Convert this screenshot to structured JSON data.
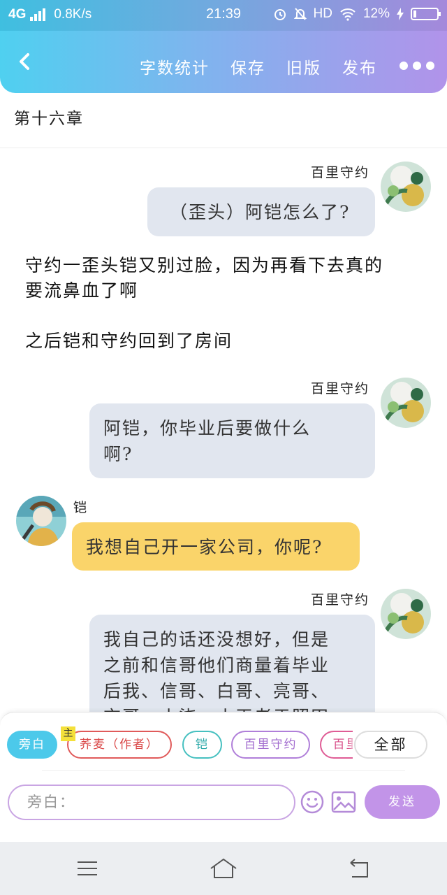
{
  "status": {
    "network": "4G",
    "speed": "0.8K/s",
    "time": "21:39",
    "hd": "HD",
    "battery_text": "12%",
    "battery_level": 0.12
  },
  "toolbar": {
    "back_icon": "chevron-left-icon",
    "actions": [
      "字数统计",
      "保存",
      "旧版",
      "发布"
    ],
    "more_icon": "more-dots-icon"
  },
  "chapter": {
    "title": "第十六章"
  },
  "feed": {
    "msg1": {
      "name": "百里守约",
      "text": "（歪头）阿铠怎么了?"
    },
    "narration1": {
      "line1": "守约一歪头铠又别过脸，因为再看下去真的",
      "line2": "要流鼻血了啊"
    },
    "narration2": {
      "text": "之后铠和守约回到了房间"
    },
    "msg2": {
      "name": "百里守约",
      "line1": "阿铠，你毕业后要做什么",
      "line2": "啊?"
    },
    "msg3": {
      "name": "铠",
      "text": "我想自己开一家公司，你呢?"
    },
    "msg4": {
      "name": "百里守约",
      "line1": "我自己的话还没想好，但是",
      "line2": "之前和信哥他们商量着毕业",
      "line3": "后我、信哥、白哥、亮哥、",
      "line4": "玄哥、小柒、小王老于照田"
    }
  },
  "chips": {
    "narrator": "旁白",
    "author_badge": "主",
    "author": "荞麦（作者）",
    "kai": "铠",
    "shouyue": "百里守约",
    "shouyue2": "百里守约",
    "all": "全部"
  },
  "input": {
    "placeholder": "旁白：",
    "send": "发送"
  },
  "colors": {
    "accent_start": "#4fd0f0",
    "accent_end": "#b193ea",
    "bubble_gray": "#e1e6ef",
    "bubble_yellow": "#fad46a",
    "send": "#c294e8"
  }
}
